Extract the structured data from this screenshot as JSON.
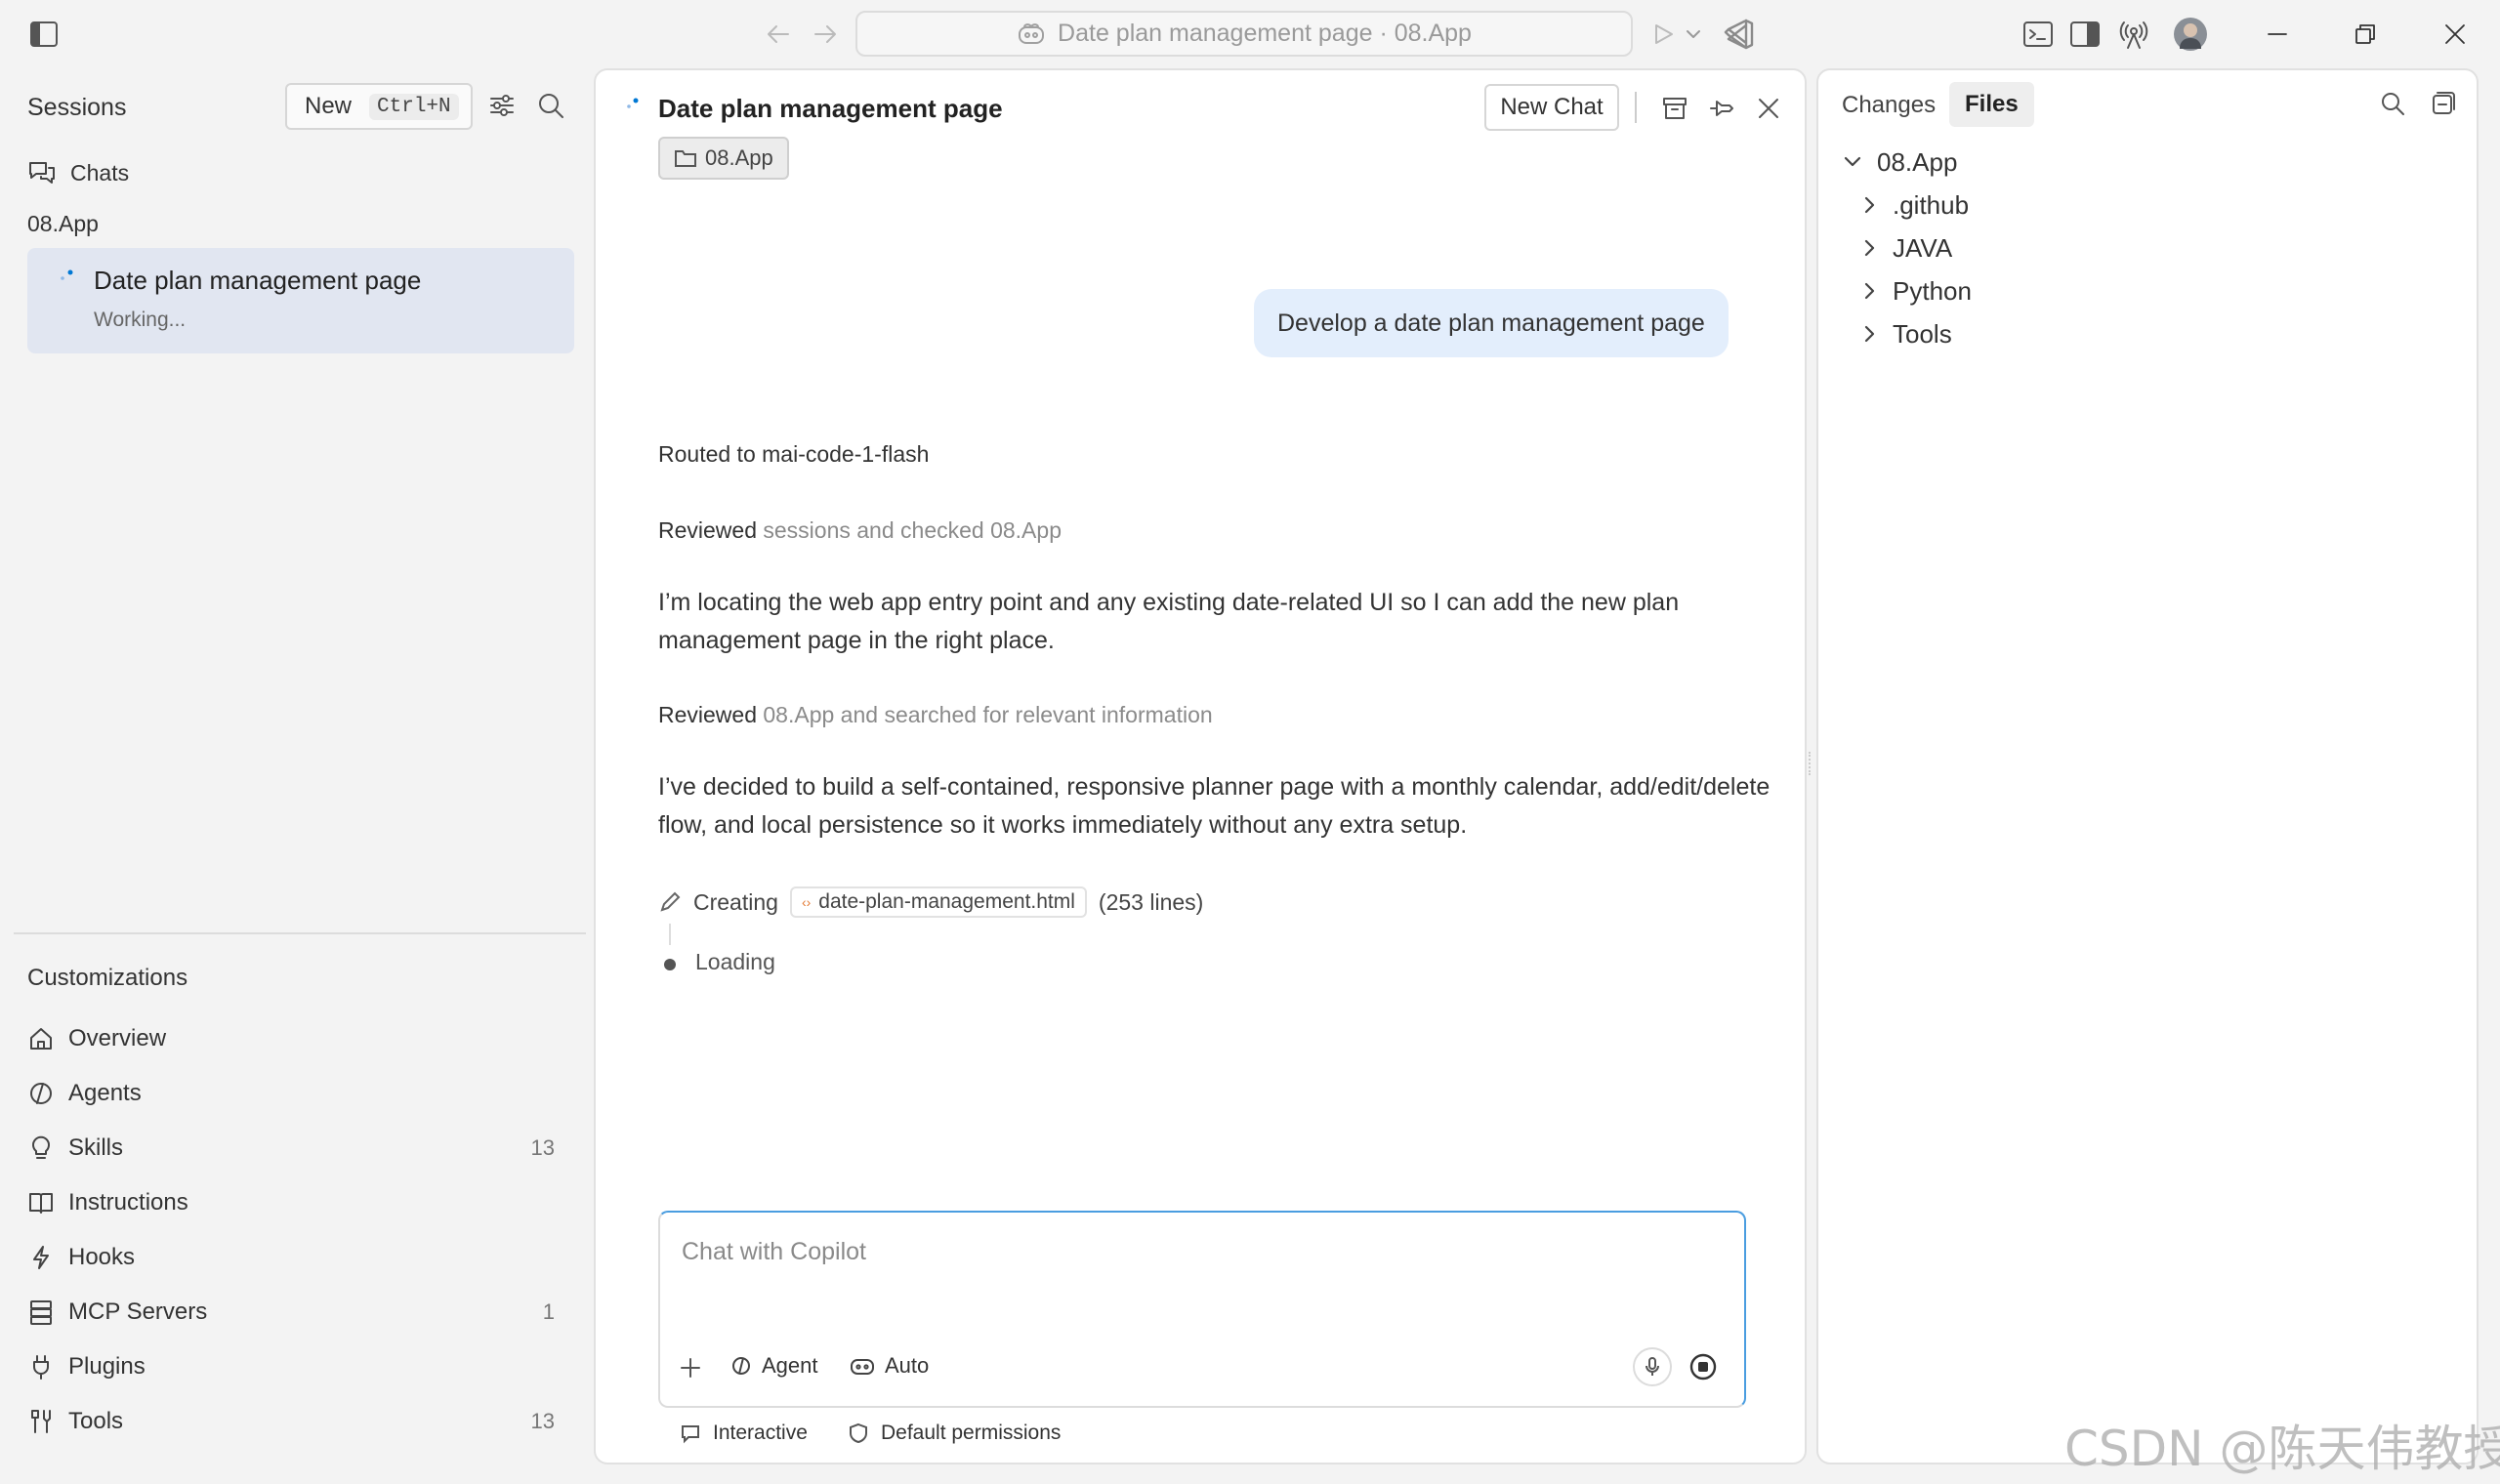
{
  "titlebar": {
    "command_center_label": "Date plan management page · 08.App"
  },
  "sidebar": {
    "sessions_title": "Sessions",
    "new_label": "New",
    "new_shortcut": "Ctrl+N",
    "chats_label": "Chats",
    "workspace_label": "08.App",
    "session": {
      "title": "Date plan management page",
      "status": "Working..."
    },
    "customizations_title": "Customizations",
    "items": [
      {
        "label": "Overview",
        "icon": "home-icon",
        "count": ""
      },
      {
        "label": "Agents",
        "icon": "agent-icon",
        "count": ""
      },
      {
        "label": "Skills",
        "icon": "lightbulb-icon",
        "count": "13"
      },
      {
        "label": "Instructions",
        "icon": "book-icon",
        "count": ""
      },
      {
        "label": "Hooks",
        "icon": "bolt-icon",
        "count": ""
      },
      {
        "label": "MCP Servers",
        "icon": "server-icon",
        "count": "1"
      },
      {
        "label": "Plugins",
        "icon": "plug-icon",
        "count": ""
      },
      {
        "label": "Tools",
        "icon": "tools-icon",
        "count": "13"
      }
    ]
  },
  "chat": {
    "title": "Date plan management page",
    "context_chip": "08.App",
    "new_chat_label": "New Chat",
    "user_message": "Develop a date plan management page",
    "routed": "Routed to mai-code-1-flash",
    "reviewed1_prefix": "Reviewed",
    "reviewed1_rest": "sessions and checked 08.App",
    "message1": "I’m locating the web app entry point and any existing date-related UI so I can add the new plan management page in the right place.",
    "reviewed2_prefix": "Reviewed",
    "reviewed2_rest": "08.App and searched for relevant information",
    "message2": "I’ve decided to build a self-contained, responsive planner page with a monthly calendar, add/edit/delete flow, and local persistence so it works immediately without any extra setup.",
    "creating_label": "Creating",
    "file_name": "date-plan-management.html",
    "file_lines": "(253 lines)",
    "loading_label": "Loading",
    "input_placeholder": "Chat with Copilot",
    "agent_label": "Agent",
    "auto_label": "Auto",
    "interactive_label": "Interactive",
    "permissions_label": "Default permissions"
  },
  "right_panel": {
    "tabs": [
      {
        "label": "Changes"
      },
      {
        "label": "Files"
      }
    ],
    "root": "08.App",
    "folders": [
      ".github",
      "JAVA",
      "Python",
      "Tools"
    ]
  },
  "watermark": "CSDN @陈天伟教授",
  "colors": {
    "accent": "#0078d4",
    "selected_session": "#e1e6f1",
    "user_bubble": "#e3eefc"
  }
}
